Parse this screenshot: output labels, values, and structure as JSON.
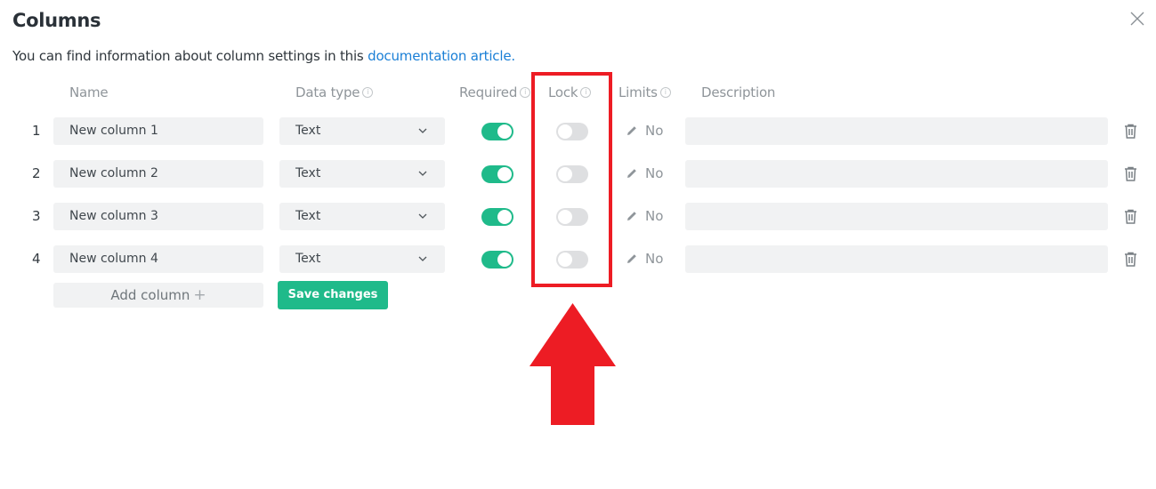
{
  "dialog": {
    "title": "Columns",
    "close_icon": "close-icon",
    "intro_text": "You can find information about column settings in this ",
    "intro_link": "documentation article."
  },
  "headers": {
    "name": "Name",
    "data_type": "Data type",
    "required": "Required",
    "lock": "Lock",
    "limits": "Limits",
    "description": "Description",
    "info_glyph": "i"
  },
  "rows": [
    {
      "index": "1",
      "name": "New column 1",
      "data_type": "Text",
      "required": true,
      "lock": false,
      "limits": "No",
      "description": ""
    },
    {
      "index": "2",
      "name": "New column 2",
      "data_type": "Text",
      "required": true,
      "lock": false,
      "limits": "No",
      "description": ""
    },
    {
      "index": "3",
      "name": "New column 3",
      "data_type": "Text",
      "required": true,
      "lock": false,
      "limits": "No",
      "description": ""
    },
    {
      "index": "4",
      "name": "New column 4",
      "data_type": "Text",
      "required": true,
      "lock": false,
      "limits": "No",
      "description": ""
    }
  ],
  "actions": {
    "add_column": "Add column",
    "add_plus": "+",
    "save_changes": "Save changes"
  },
  "colors": {
    "accent": "#1fba8a",
    "link": "#1a7fd6",
    "annotation": "#ed1c24",
    "toggle_off": "#dedfe1"
  },
  "annotation": {
    "highlight": "lock-column",
    "arrow_direction": "up"
  }
}
